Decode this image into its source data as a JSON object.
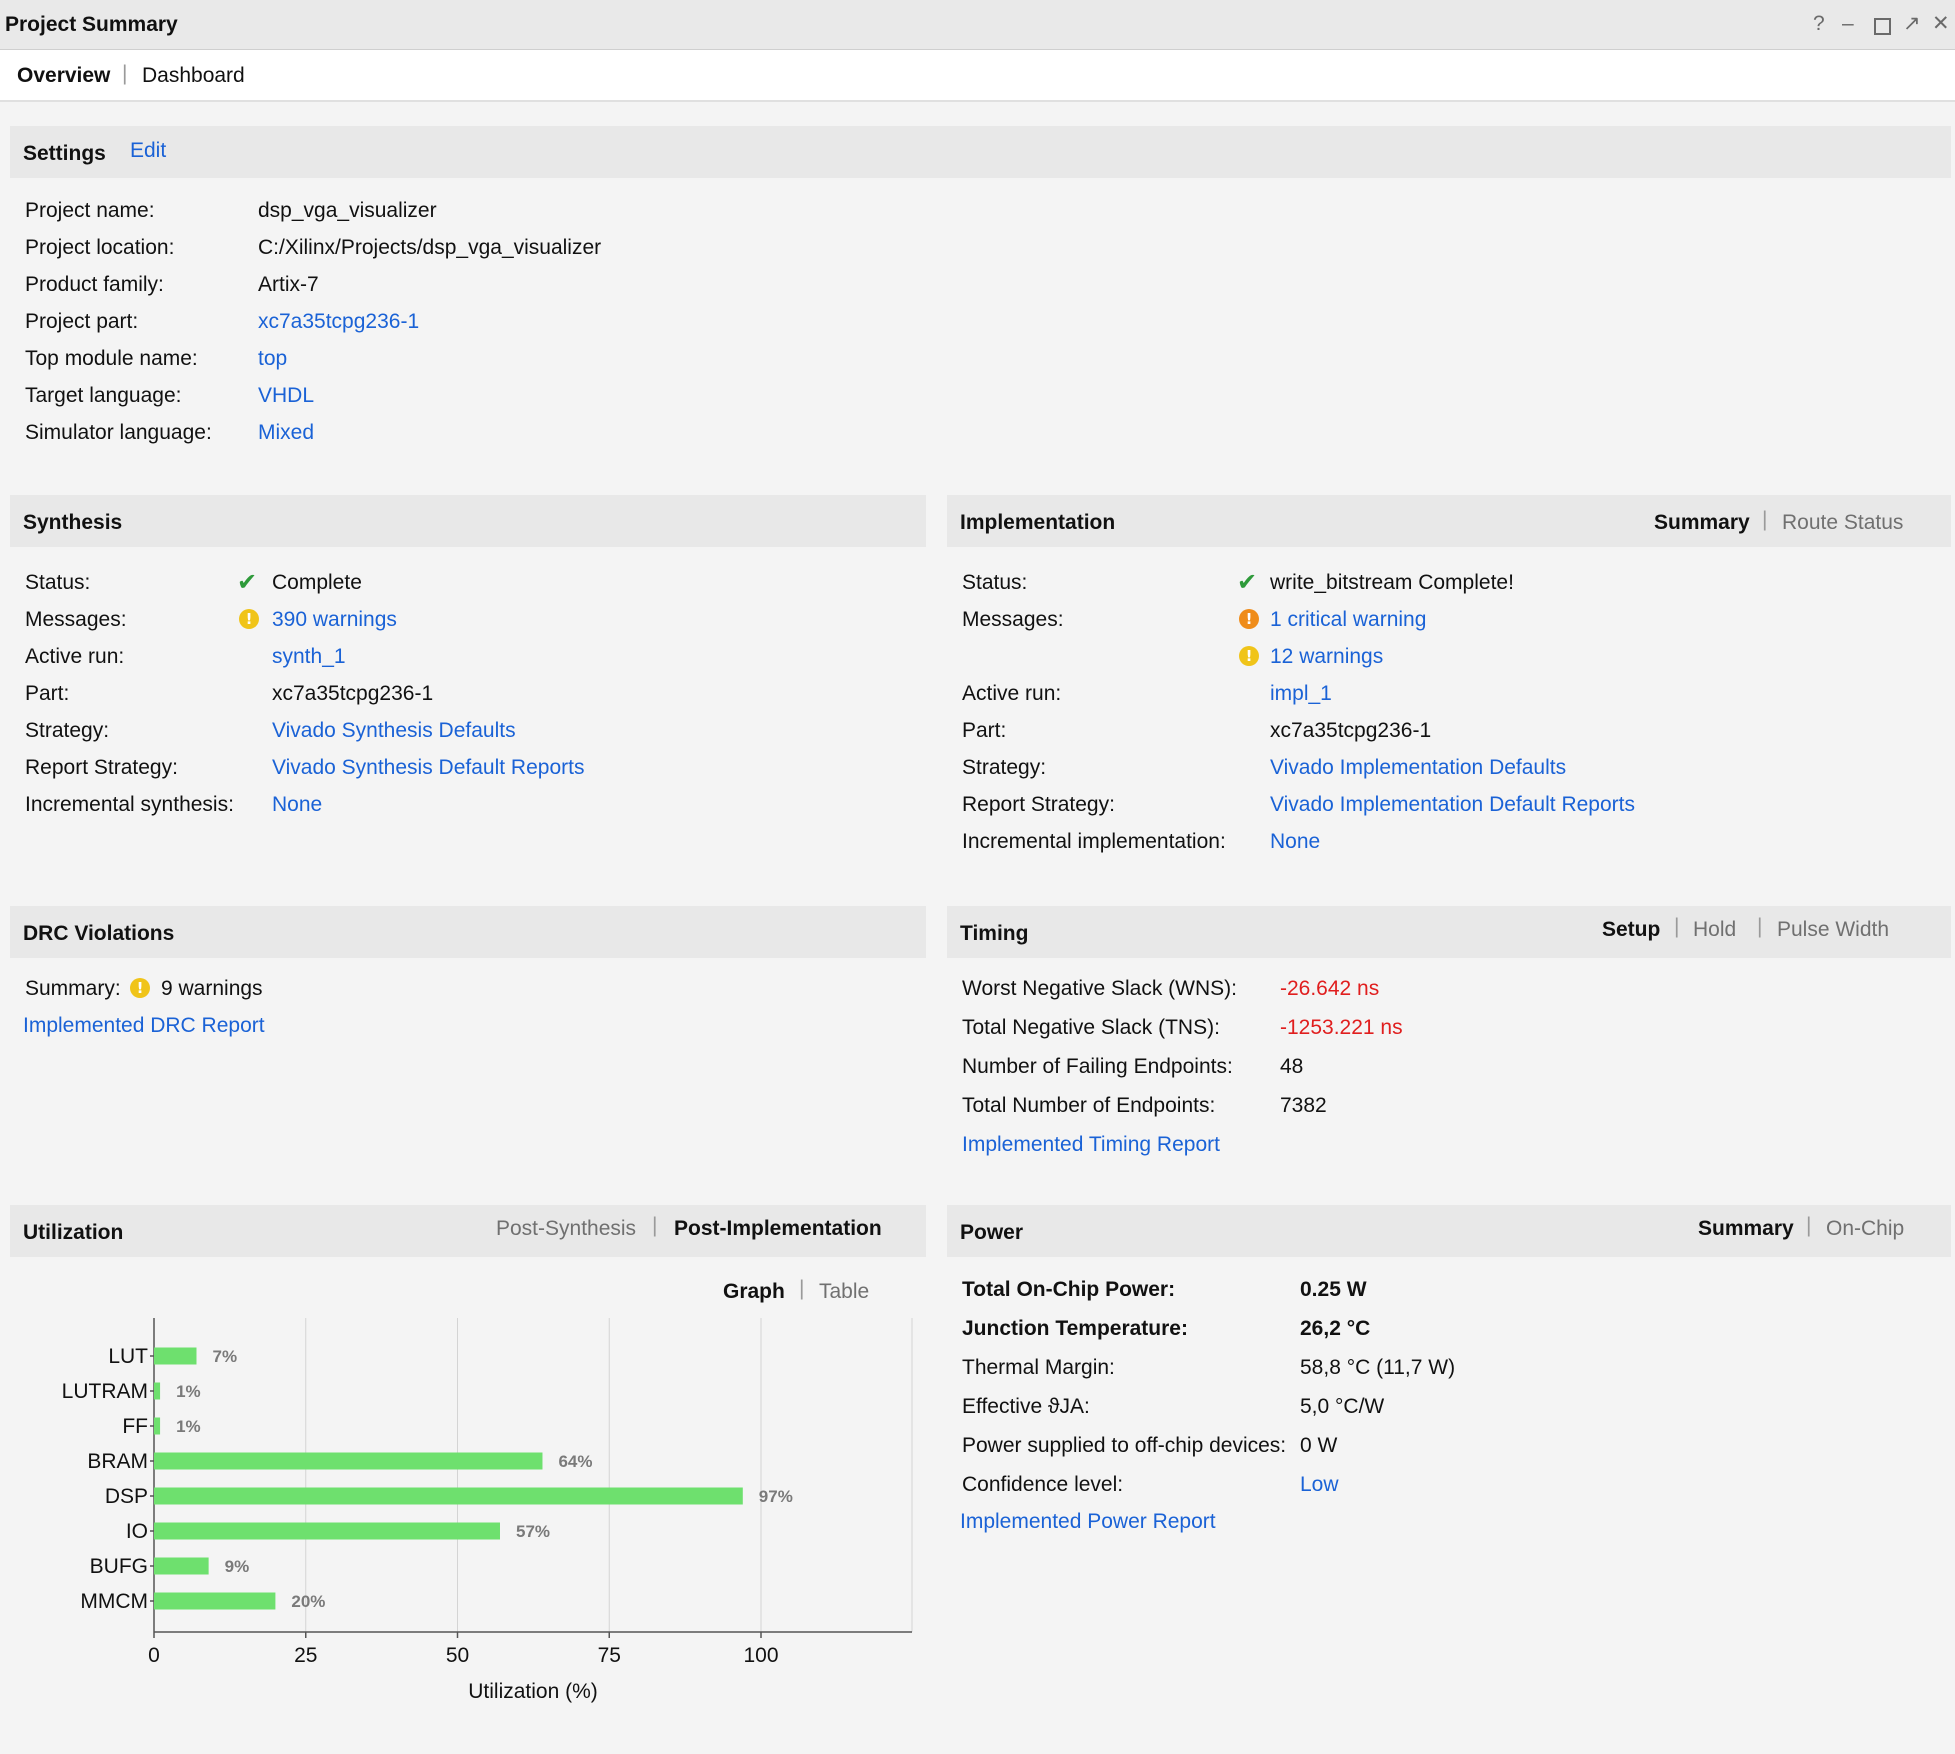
{
  "window": {
    "title": "Project Summary"
  },
  "top_tabs": {
    "overview": "Overview",
    "dashboard": "Dashboard"
  },
  "settings": {
    "title": "Settings",
    "edit": "Edit",
    "rows": [
      {
        "label": "Project name:",
        "value": "dsp_vga_visualizer",
        "link": false
      },
      {
        "label": "Project location:",
        "value": "C:/Xilinx/Projects/dsp_vga_visualizer",
        "link": false
      },
      {
        "label": "Product family:",
        "value": "Artix-7",
        "link": false
      },
      {
        "label": "Project part:",
        "value": "xc7a35tcpg236-1",
        "link": true
      },
      {
        "label": "Top module name:",
        "value": "top",
        "link": true
      },
      {
        "label": "Target language:",
        "value": "VHDL",
        "link": true
      },
      {
        "label": "Simulator language:",
        "value": "Mixed",
        "link": true
      }
    ]
  },
  "synthesis": {
    "title": "Synthesis",
    "status_label": "Status:",
    "status_value": "Complete",
    "messages_label": "Messages:",
    "messages_value": "390 warnings",
    "active_run_label": "Active run:",
    "active_run_value": "synth_1",
    "part_label": "Part:",
    "part_value": "xc7a35tcpg236-1",
    "strategy_label": "Strategy:",
    "strategy_value": "Vivado Synthesis Defaults",
    "report_strategy_label": "Report Strategy:",
    "report_strategy_value": "Vivado Synthesis Default Reports",
    "incremental_label": "Incremental synthesis:",
    "incremental_value": "None"
  },
  "implementation": {
    "title": "Implementation",
    "tabs": {
      "summary": "Summary",
      "route_status": "Route Status"
    },
    "status_label": "Status:",
    "status_value": "write_bitstream Complete!",
    "messages_label": "Messages:",
    "critical_value": "1 critical warning",
    "warnings_value": "12 warnings",
    "active_run_label": "Active run:",
    "active_run_value": "impl_1",
    "part_label": "Part:",
    "part_value": "xc7a35tcpg236-1",
    "strategy_label": "Strategy:",
    "strategy_value": "Vivado Implementation Defaults",
    "report_strategy_label": "Report Strategy:",
    "report_strategy_value": "Vivado Implementation Default Reports",
    "incremental_label": "Incremental implementation:",
    "incremental_value": "None"
  },
  "drc": {
    "title": "DRC Violations",
    "summary_label": "Summary:",
    "summary_value": "9 warnings",
    "report_link": "Implemented DRC Report"
  },
  "timing": {
    "title": "Timing",
    "tabs": {
      "setup": "Setup",
      "hold": "Hold",
      "pulse_width": "Pulse Width"
    },
    "wns_label": "Worst Negative Slack (WNS):",
    "wns_value": "-26.642 ns",
    "tns_label": "Total Negative Slack (TNS):",
    "tns_value": "-1253.221 ns",
    "failing_label": "Number of Failing Endpoints:",
    "failing_value": "48",
    "total_label": "Total Number of Endpoints:",
    "total_value": "7382",
    "report_link": "Implemented Timing Report"
  },
  "utilization": {
    "title": "Utilization",
    "tabs": {
      "post_synthesis": "Post-Synthesis",
      "post_implementation": "Post-Implementation"
    },
    "view_tabs": {
      "graph": "Graph",
      "table": "Table"
    }
  },
  "power": {
    "title": "Power",
    "tabs": {
      "summary": "Summary",
      "on_chip": "On-Chip"
    },
    "total_label": "Total On-Chip Power:",
    "total_value": "0.25 W",
    "junction_label": "Junction Temperature:",
    "junction_value": "26,2 °C",
    "thermal_label": "Thermal Margin:",
    "thermal_value": "58,8 °C (11,7 W)",
    "theta_label": "Effective ϑJA:",
    "theta_value": "5,0 °C/W",
    "offchip_label": "Power supplied to off-chip devices:",
    "offchip_value": "0 W",
    "confidence_label": "Confidence level:",
    "confidence_value": "Low",
    "report_link": "Implemented Power Report"
  },
  "colors": {
    "link": "#1a62d6",
    "bar": "#6ee06e",
    "negative": "#e01e1e",
    "check": "#2e9a3a"
  },
  "chart_data": {
    "type": "bar",
    "orientation": "horizontal",
    "categories": [
      "LUT",
      "LUTRAM",
      "FF",
      "BRAM",
      "DSP",
      "IO",
      "BUFG",
      "MMCM"
    ],
    "values": [
      7,
      1,
      1,
      64,
      97,
      57,
      9,
      20
    ],
    "value_labels": [
      "7%",
      "1%",
      "1%",
      "64%",
      "97%",
      "57%",
      "9%",
      "20%"
    ],
    "xlabel": "Utilization (%)",
    "xticks": [
      "0",
      "25",
      "50",
      "75",
      "100"
    ],
    "xlim": [
      0,
      125
    ],
    "grid": true,
    "bar_color": "#6ee06e"
  }
}
